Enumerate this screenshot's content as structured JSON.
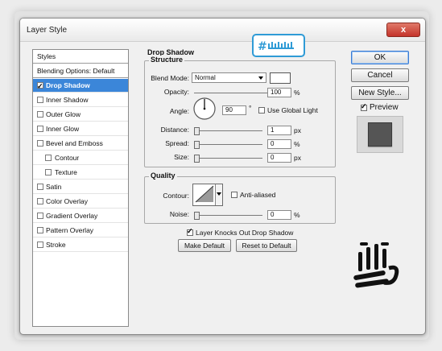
{
  "window": {
    "title": "Layer Style",
    "close_symbol": "x"
  },
  "styles_panel": {
    "header": "Styles",
    "blending": "Blending Options: Default",
    "items": [
      {
        "label": "Drop Shadow",
        "checked": true,
        "selected": true
      },
      {
        "label": "Inner Shadow",
        "checked": false
      },
      {
        "label": "Outer Glow",
        "checked": false
      },
      {
        "label": "Inner Glow",
        "checked": false
      },
      {
        "label": "Bevel and Emboss",
        "checked": false
      },
      {
        "label": "Contour",
        "checked": false,
        "indent": true
      },
      {
        "label": "Texture",
        "checked": false,
        "indent": true
      },
      {
        "label": "Satin",
        "checked": false
      },
      {
        "label": "Color Overlay",
        "checked": false
      },
      {
        "label": "Gradient Overlay",
        "checked": false
      },
      {
        "label": "Pattern Overlay",
        "checked": false
      },
      {
        "label": "Stroke",
        "checked": false
      }
    ]
  },
  "drop_shadow": {
    "section_title": "Drop Shadow",
    "structure": {
      "title": "Structure",
      "blend_mode_label": "Blend Mode:",
      "blend_mode_value": "Normal",
      "blend_color": "#ffffff",
      "opacity_label": "Opacity:",
      "opacity_value": "100",
      "opacity_unit": "%",
      "opacity_level": 1.0,
      "angle_label": "Angle:",
      "angle_value": "90",
      "angle_unit": "°",
      "use_global_light_label": "Use Global Light",
      "distance_label": "Distance:",
      "distance_value": "1",
      "distance_unit": "px",
      "spread_label": "Spread:",
      "spread_value": "0",
      "spread_unit": "%",
      "size_label": "Size:",
      "size_value": "0",
      "size_unit": "px"
    },
    "quality": {
      "title": "Quality",
      "contour_label": "Contour:",
      "anti_aliased_label": "Anti-aliased",
      "noise_label": "Noise:",
      "noise_value": "0",
      "noise_unit": "%"
    },
    "knockout_label": "Layer Knocks Out Drop Shadow",
    "knockout_checked": true,
    "make_default": "Make Default",
    "reset_default": "Reset to Default"
  },
  "buttons": {
    "ok": "OK",
    "cancel": "Cancel",
    "new_style": "New Style...",
    "preview": "Preview",
    "preview_checked": true
  },
  "colors": {
    "accent": "#3b86d9",
    "watermark_blue": "#2f9bd6",
    "preview_swatch": "#555555"
  }
}
